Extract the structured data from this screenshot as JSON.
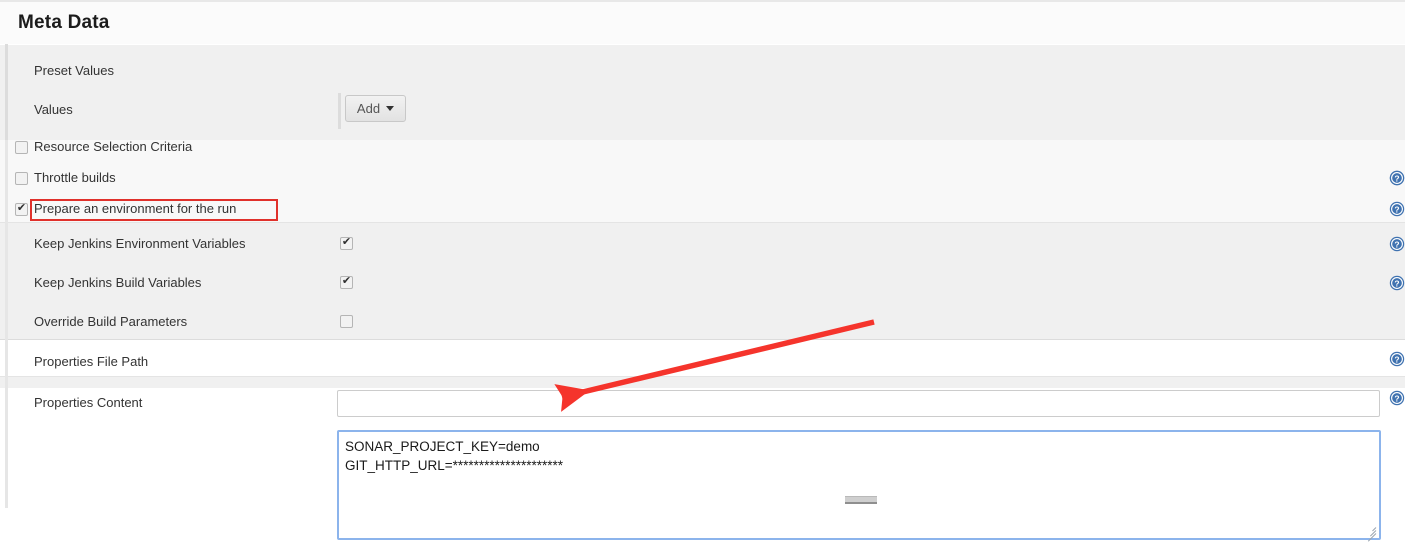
{
  "header": {
    "title": "Meta Data"
  },
  "preset_section": {
    "preset_values_label": "Preset Values",
    "values_label": "Values",
    "add_button_label": "Add"
  },
  "options": [
    {
      "label": "Resource Selection Criteria",
      "checked": false,
      "highlighted": false
    },
    {
      "label": "Throttle builds",
      "checked": false,
      "highlighted": false
    },
    {
      "label": "Prepare an environment for the run",
      "checked": true,
      "highlighted": true
    }
  ],
  "environment_fields": [
    {
      "label": "Keep Jenkins Environment Variables",
      "checked": true
    },
    {
      "label": "Keep Jenkins Build Variables",
      "checked": true
    },
    {
      "label": "Override Build Parameters",
      "checked": false
    }
  ],
  "properties_file_path": {
    "label": "Properties File Path",
    "value": "",
    "placeholder": ""
  },
  "properties_content": {
    "label": "Properties Content",
    "value": "SONAR_PROJECT_KEY=demo\nGIT_HTTP_URL=*********************"
  },
  "help_icons": [
    {
      "name": "help-icon-throttle-builds"
    },
    {
      "name": "help-icon-prepare-environment"
    },
    {
      "name": "help-icon-keep-environment-variables"
    },
    {
      "name": "help-icon-keep-build-variables"
    },
    {
      "name": "help-icon-properties-file-path"
    },
    {
      "name": "help-icon-properties-content"
    }
  ],
  "annotation": {
    "arrow_color": "#f5342c",
    "highlight_color": "#e0312b"
  }
}
